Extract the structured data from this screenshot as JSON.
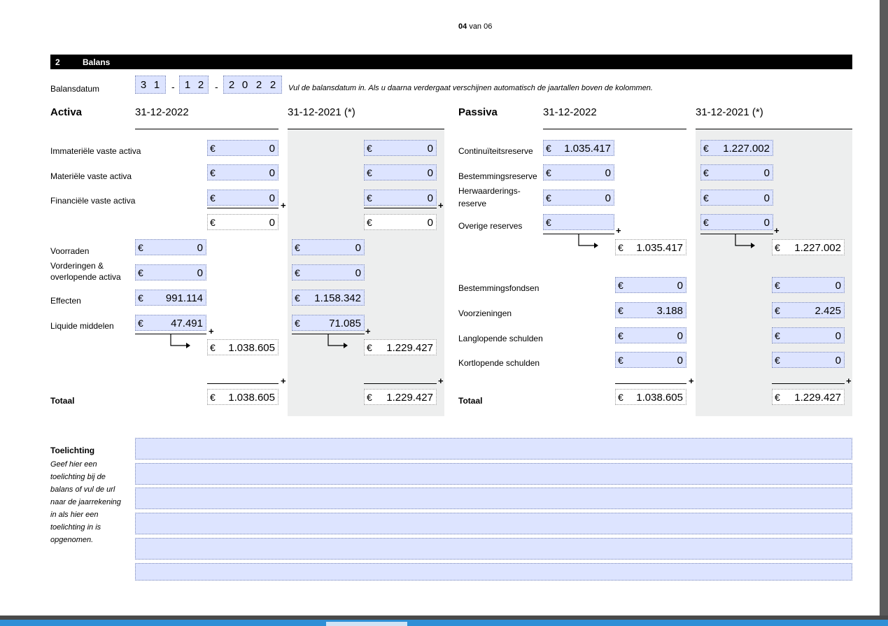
{
  "page_number": {
    "current": "04",
    "suffix": "van 06"
  },
  "section": {
    "number": "2",
    "title": "Balans"
  },
  "balansdatum": {
    "label": "Balansdatum",
    "day": [
      "3",
      "1"
    ],
    "month": [
      "1",
      "2"
    ],
    "year": [
      "2",
      "0",
      "2",
      "2"
    ],
    "separator": "-",
    "note": "Vul de balansdatum in. Als u daarna verdergaat verschijnen automatisch de jaartallen boven de kolommen."
  },
  "currency": "€",
  "plus": "+",
  "activa": {
    "title": "Activa",
    "col1": "31-12-2022",
    "col2": "31-12-2021 (*)",
    "immaterieel": {
      "label": "Immateriële vaste activa",
      "v1": "0",
      "v2": "0"
    },
    "materieel": {
      "label": "Materiële vaste activa",
      "v1": "0",
      "v2": "0"
    },
    "financieel": {
      "label": "Financiële vaste activa",
      "v1": "0",
      "v2": "0"
    },
    "vaste_subtotaal": {
      "v1": "0",
      "v2": "0"
    },
    "voorraden": {
      "label": "Voorraden",
      "v1": "0",
      "v2": "0"
    },
    "vorderingen": {
      "label": "Vorderingen & overlopende activa",
      "v1": "0",
      "v2": "0"
    },
    "effecten": {
      "label": "Effecten",
      "v1": "991.114",
      "v2": "1.158.342"
    },
    "liquide": {
      "label": "Liquide middelen",
      "v1": "47.491",
      "v2": "71.085"
    },
    "vlottende_subtotaal": {
      "v1": "1.038.605",
      "v2": "1.229.427"
    },
    "totaal": {
      "label": "Totaal",
      "v1": "1.038.605",
      "v2": "1.229.427"
    }
  },
  "passiva": {
    "title": "Passiva",
    "col1": "31-12-2022",
    "col2": "31-12-2021 (*)",
    "continuiteit": {
      "label": "Continuïteitsreserve",
      "v1": "1.035.417",
      "v2": "1.227.002"
    },
    "bestemmingsreserve": {
      "label": "Bestemmingsreserve",
      "v1": "0",
      "v2": "0"
    },
    "herwaardering": {
      "label1": "Herwaarderings-",
      "label2": "reserve",
      "v1": "0",
      "v2": "0"
    },
    "overige": {
      "label": "Overige reserves",
      "v1": "",
      "v2": "0"
    },
    "reserves_subtotaal": {
      "v1": "1.035.417",
      "v2": "1.227.002"
    },
    "bestemmingsfondsen": {
      "label": "Bestemmingsfondsen",
      "v1": "0",
      "v2": "0"
    },
    "voorzieningen": {
      "label": "Voorzieningen",
      "v1": "3.188",
      "v2": "2.425"
    },
    "langlopend": {
      "label": "Langlopende schulden",
      "v1": "0",
      "v2": "0"
    },
    "kortlopend": {
      "label": "Kortlopende schulden",
      "v1": "0",
      "v2": "0"
    },
    "totaal": {
      "label": "Totaal",
      "v1": "1.038.605",
      "v2": "1.229.427"
    }
  },
  "toelichting": {
    "title": "Toelichting",
    "description": "Geef hier een toelichting bij de balans of vul de url naar de jaarrekening in als hier een toelichting in is opgenomen.",
    "lines": [
      "",
      "",
      "",
      "",
      "",
      ""
    ]
  }
}
